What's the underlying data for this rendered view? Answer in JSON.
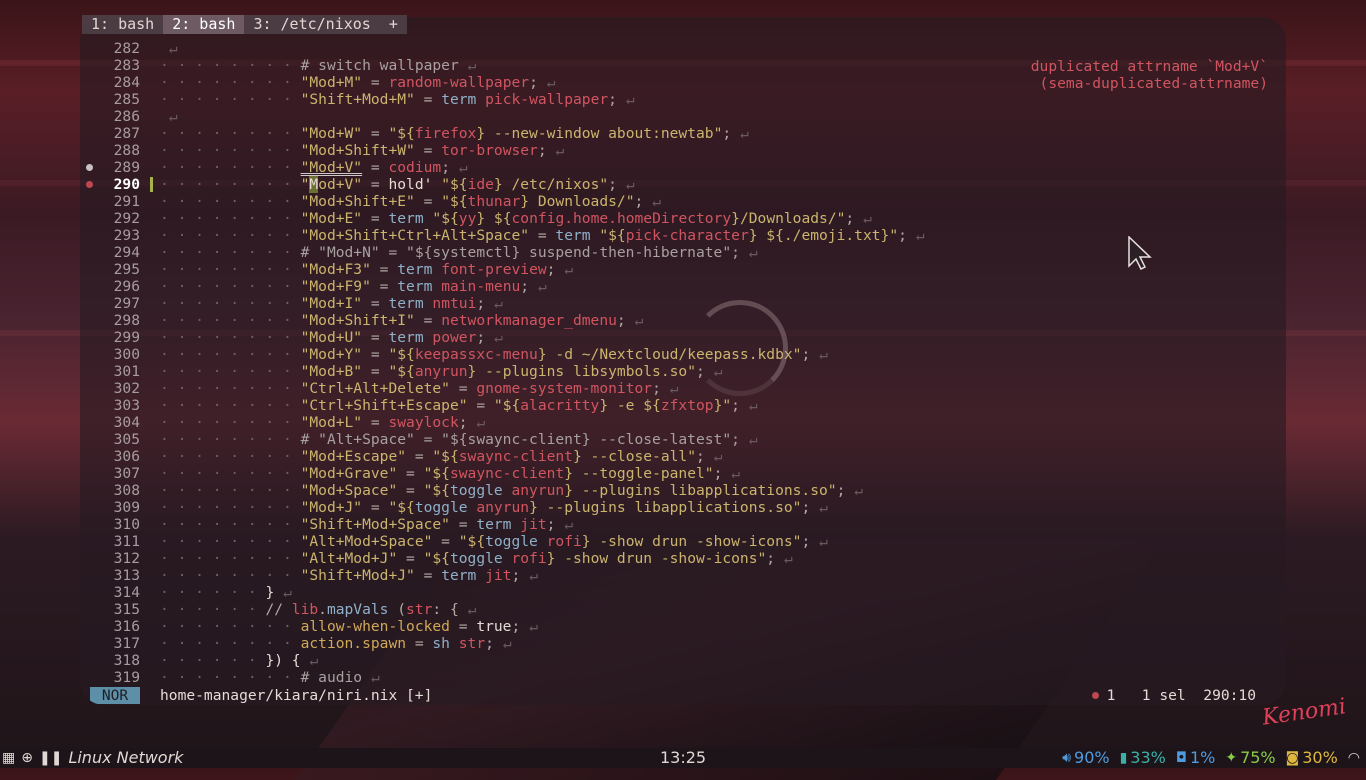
{
  "tabs": [
    {
      "label": "1: bash",
      "active": false
    },
    {
      "label": "2: bash",
      "active": true
    },
    {
      "label": "3: /etc/nixos",
      "active": false
    },
    {
      "label": "+",
      "active": false
    }
  ],
  "diagnostic": {
    "line1": "duplicated attrname `Mod+V`",
    "line2": "(sema-duplicated-attrname)"
  },
  "lines": [
    {
      "n": "282",
      "depth": 0,
      "tokens": []
    },
    {
      "n": "283",
      "depth": 4,
      "tokens": [
        [
          "c",
          "# switch wallpaper"
        ]
      ]
    },
    {
      "n": "284",
      "depth": 4,
      "tokens": [
        [
          "s",
          "\"Mod+M\""
        ],
        [
          "o",
          " = "
        ],
        [
          "e",
          "random-wallpaper"
        ],
        [
          "o",
          ";"
        ]
      ]
    },
    {
      "n": "285",
      "depth": 4,
      "tokens": [
        [
          "s",
          "\"Shift+Mod+M\""
        ],
        [
          "o",
          " = "
        ],
        [
          "k",
          "term"
        ],
        [
          "o",
          " "
        ],
        [
          "e",
          "pick-wallpaper"
        ],
        [
          "o",
          ";"
        ]
      ]
    },
    {
      "n": "286",
      "depth": 0,
      "tokens": []
    },
    {
      "n": "287",
      "depth": 4,
      "tokens": [
        [
          "s",
          "\"Mod+W\""
        ],
        [
          "o",
          " = "
        ],
        [
          "s",
          "\"${"
        ],
        [
          "e",
          "firefox"
        ],
        [
          "s",
          "} --new-window about:newtab\""
        ],
        [
          "o",
          ";"
        ]
      ]
    },
    {
      "n": "288",
      "depth": 4,
      "tokens": [
        [
          "s",
          "\"Mod+Shift+W\""
        ],
        [
          "o",
          " = "
        ],
        [
          "e",
          "tor-browser"
        ],
        [
          "o",
          ";"
        ]
      ]
    },
    {
      "n": "289",
      "depth": 4,
      "gutter": "info",
      "tokens": [
        [
          "su",
          "\"Mod+V\""
        ],
        [
          "o",
          " = "
        ],
        [
          "e",
          "codium"
        ],
        [
          "o",
          ";"
        ]
      ]
    },
    {
      "n": "290",
      "depth": 4,
      "gutter": "err",
      "current": true,
      "changed": true,
      "tokens": [
        [
          "s",
          "\""
        ],
        [
          "hl",
          "M"
        ],
        [
          "s",
          "od+V\""
        ],
        [
          "o",
          " = "
        ],
        [
          "w",
          "hold' "
        ],
        [
          "s",
          "\"${"
        ],
        [
          "e",
          "ide"
        ],
        [
          "s",
          "} /etc/nixos\""
        ],
        [
          "o",
          ";"
        ]
      ]
    },
    {
      "n": "291",
      "depth": 4,
      "tokens": [
        [
          "s",
          "\"Mod+Shift+E\""
        ],
        [
          "o",
          " = "
        ],
        [
          "s",
          "\"${"
        ],
        [
          "e",
          "thunar"
        ],
        [
          "s",
          "} Downloads/\""
        ],
        [
          "o",
          ";"
        ]
      ]
    },
    {
      "n": "292",
      "depth": 4,
      "tokens": [
        [
          "s",
          "\"Mod+E\""
        ],
        [
          "o",
          " = "
        ],
        [
          "k",
          "term"
        ],
        [
          "o",
          " "
        ],
        [
          "s",
          "\"${"
        ],
        [
          "e",
          "yy"
        ],
        [
          "s",
          "} ${"
        ],
        [
          "e",
          "config.home.homeDirectory"
        ],
        [
          "s",
          "}/Downloads/\""
        ],
        [
          "o",
          ";"
        ]
      ]
    },
    {
      "n": "293",
      "depth": 4,
      "tokens": [
        [
          "s",
          "\"Mod+Shift+Ctrl+Alt+Space\""
        ],
        [
          "o",
          " = "
        ],
        [
          "k",
          "term"
        ],
        [
          "o",
          " "
        ],
        [
          "s",
          "\"${"
        ],
        [
          "e",
          "pick-character"
        ],
        [
          "s",
          "} ${./emoji.txt}\""
        ],
        [
          "o",
          ";"
        ]
      ]
    },
    {
      "n": "294",
      "depth": 4,
      "tokens": [
        [
          "c",
          "# \"Mod+N\" = \"${systemctl} suspend-then-hibernate\";"
        ]
      ]
    },
    {
      "n": "295",
      "depth": 4,
      "tokens": [
        [
          "s",
          "\"Mod+F3\""
        ],
        [
          "o",
          " = "
        ],
        [
          "k",
          "term"
        ],
        [
          "o",
          " "
        ],
        [
          "e",
          "font-preview"
        ],
        [
          "o",
          ";"
        ]
      ]
    },
    {
      "n": "296",
      "depth": 4,
      "tokens": [
        [
          "s",
          "\"Mod+F9\""
        ],
        [
          "o",
          " = "
        ],
        [
          "k",
          "term"
        ],
        [
          "o",
          " "
        ],
        [
          "e",
          "main-menu"
        ],
        [
          "o",
          ";"
        ]
      ]
    },
    {
      "n": "297",
      "depth": 4,
      "tokens": [
        [
          "s",
          "\"Mod+I\""
        ],
        [
          "o",
          " = "
        ],
        [
          "k",
          "term"
        ],
        [
          "o",
          " "
        ],
        [
          "e",
          "nmtui"
        ],
        [
          "o",
          ";"
        ]
      ]
    },
    {
      "n": "298",
      "depth": 4,
      "tokens": [
        [
          "s",
          "\"Mod+Shift+I\""
        ],
        [
          "o",
          " = "
        ],
        [
          "e",
          "networkmanager_dmenu"
        ],
        [
          "o",
          ";"
        ]
      ]
    },
    {
      "n": "299",
      "depth": 4,
      "tokens": [
        [
          "s",
          "\"Mod+U\""
        ],
        [
          "o",
          " = "
        ],
        [
          "k",
          "term"
        ],
        [
          "o",
          " "
        ],
        [
          "e",
          "power"
        ],
        [
          "o",
          ";"
        ]
      ]
    },
    {
      "n": "300",
      "depth": 4,
      "tokens": [
        [
          "s",
          "\"Mod+Y\""
        ],
        [
          "o",
          " = "
        ],
        [
          "s",
          "\"${"
        ],
        [
          "e",
          "keepassxc-menu"
        ],
        [
          "s",
          "} -d ~/Nextcloud/keepass.kdbx\""
        ],
        [
          "o",
          ";"
        ]
      ]
    },
    {
      "n": "301",
      "depth": 4,
      "tokens": [
        [
          "s",
          "\"Mod+B\""
        ],
        [
          "o",
          " = "
        ],
        [
          "s",
          "\"${"
        ],
        [
          "e",
          "anyrun"
        ],
        [
          "s",
          "} --plugins libsymbols.so\""
        ],
        [
          "o",
          ";"
        ]
      ]
    },
    {
      "n": "302",
      "depth": 4,
      "tokens": [
        [
          "s",
          "\"Ctrl+Alt+Delete\""
        ],
        [
          "o",
          " = "
        ],
        [
          "e",
          "gnome-system-monitor"
        ],
        [
          "o",
          ";"
        ]
      ]
    },
    {
      "n": "303",
      "depth": 4,
      "tokens": [
        [
          "s",
          "\"Ctrl+Shift+Escape\""
        ],
        [
          "o",
          " = "
        ],
        [
          "s",
          "\"${"
        ],
        [
          "e",
          "alacritty"
        ],
        [
          "s",
          "} -e ${"
        ],
        [
          "e",
          "zfxtop"
        ],
        [
          "s",
          "}\""
        ],
        [
          "o",
          ";"
        ]
      ]
    },
    {
      "n": "304",
      "depth": 4,
      "tokens": [
        [
          "s",
          "\"Mod+L\""
        ],
        [
          "o",
          " = "
        ],
        [
          "e",
          "swaylock"
        ],
        [
          "o",
          ";"
        ]
      ]
    },
    {
      "n": "305",
      "depth": 4,
      "tokens": [
        [
          "c",
          "# \"Alt+Space\" = \"${swaync-client} --close-latest\";"
        ]
      ]
    },
    {
      "n": "306",
      "depth": 4,
      "tokens": [
        [
          "s",
          "\"Mod+Escape\""
        ],
        [
          "o",
          " = "
        ],
        [
          "s",
          "\"${"
        ],
        [
          "e",
          "swaync-client"
        ],
        [
          "s",
          "} --close-all\""
        ],
        [
          "o",
          ";"
        ]
      ]
    },
    {
      "n": "307",
      "depth": 4,
      "tokens": [
        [
          "s",
          "\"Mod+Grave\""
        ],
        [
          "o",
          " = "
        ],
        [
          "s",
          "\"${"
        ],
        [
          "e",
          "swaync-client"
        ],
        [
          "s",
          "} --toggle-panel\""
        ],
        [
          "o",
          ";"
        ]
      ]
    },
    {
      "n": "308",
      "depth": 4,
      "tokens": [
        [
          "s",
          "\"Mod+Space\""
        ],
        [
          "o",
          " = "
        ],
        [
          "s",
          "\"${"
        ],
        [
          "k",
          "toggle"
        ],
        [
          "o",
          " "
        ],
        [
          "e",
          "anyrun"
        ],
        [
          "s",
          "} --plugins libapplications.so\""
        ],
        [
          "o",
          ";"
        ]
      ]
    },
    {
      "n": "309",
      "depth": 4,
      "tokens": [
        [
          "s",
          "\"Mod+J\""
        ],
        [
          "o",
          " = "
        ],
        [
          "s",
          "\"${"
        ],
        [
          "k",
          "toggle"
        ],
        [
          "o",
          " "
        ],
        [
          "e",
          "anyrun"
        ],
        [
          "s",
          "} --plugins libapplications.so\""
        ],
        [
          "o",
          ";"
        ]
      ]
    },
    {
      "n": "310",
      "depth": 4,
      "tokens": [
        [
          "s",
          "\"Shift+Mod+Space\""
        ],
        [
          "o",
          " = "
        ],
        [
          "k",
          "term"
        ],
        [
          "o",
          " "
        ],
        [
          "e",
          "jit"
        ],
        [
          "o",
          ";"
        ]
      ]
    },
    {
      "n": "311",
      "depth": 4,
      "tokens": [
        [
          "s",
          "\"Alt+Mod+Space\""
        ],
        [
          "o",
          " = "
        ],
        [
          "s",
          "\"${"
        ],
        [
          "k",
          "toggle"
        ],
        [
          "o",
          " "
        ],
        [
          "e",
          "rofi"
        ],
        [
          "s",
          "} -show drun -show-icons\""
        ],
        [
          "o",
          ";"
        ]
      ]
    },
    {
      "n": "312",
      "depth": 4,
      "tokens": [
        [
          "s",
          "\"Alt+Mod+J\""
        ],
        [
          "o",
          " = "
        ],
        [
          "s",
          "\"${"
        ],
        [
          "k",
          "toggle"
        ],
        [
          "o",
          " "
        ],
        [
          "e",
          "rofi"
        ],
        [
          "s",
          "} -show drun -show-icons\""
        ],
        [
          "o",
          ";"
        ]
      ]
    },
    {
      "n": "313",
      "depth": 4,
      "tokens": [
        [
          "s",
          "\"Shift+Mod+J\""
        ],
        [
          "o",
          " = "
        ],
        [
          "k",
          "term"
        ],
        [
          "o",
          " "
        ],
        [
          "e",
          "jit"
        ],
        [
          "o",
          ";"
        ]
      ]
    },
    {
      "n": "314",
      "depth": 3,
      "tokens": [
        [
          "w",
          "}"
        ]
      ]
    },
    {
      "n": "315",
      "depth": 3,
      "tokens": [
        [
          "o",
          "// "
        ],
        [
          "e",
          "lib"
        ],
        [
          "o",
          "."
        ],
        [
          "k",
          "mapVals"
        ],
        [
          "o",
          " ("
        ],
        [
          "e",
          "str"
        ],
        [
          "o",
          ": {"
        ]
      ]
    },
    {
      "n": "316",
      "depth": 4,
      "tokens": [
        [
          "b",
          "allow-when-locked"
        ],
        [
          "o",
          " = "
        ],
        [
          "w",
          "true"
        ],
        [
          "o",
          ";"
        ]
      ]
    },
    {
      "n": "317",
      "depth": 4,
      "tokens": [
        [
          "b",
          "action.spawn"
        ],
        [
          "o",
          " = "
        ],
        [
          "k",
          "sh"
        ],
        [
          "o",
          " "
        ],
        [
          "e",
          "str"
        ],
        [
          "o",
          ";"
        ]
      ]
    },
    {
      "n": "318",
      "depth": 3,
      "tokens": [
        [
          "w",
          "}) {"
        ]
      ]
    },
    {
      "n": "319",
      "depth": 4,
      "tokens": [
        [
          "c",
          "# audio"
        ]
      ]
    }
  ],
  "statusline": {
    "mode": "NOR",
    "file": "home-manager/kiara/niri.nix [+]",
    "diag_count": "1",
    "selections": "1 sel",
    "position": "290:10"
  },
  "signature": "Kenomi",
  "taskbar": {
    "workspace": "Linux Network",
    "clock": "13:25",
    "volume": "90%",
    "battery": "33%",
    "cpu": "1%",
    "brightness": "75%",
    "temp": "30%"
  },
  "colors": {
    "accent_mode": "#5d8fa8",
    "error": "#c0474f",
    "string": "#cbb46e",
    "blue": "#4f9be0"
  }
}
